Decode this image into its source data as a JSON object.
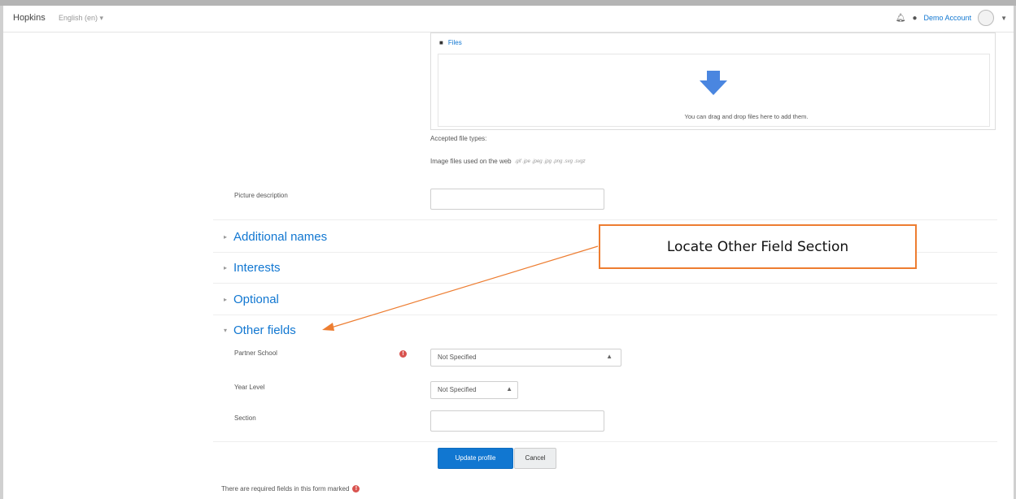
{
  "navbar": {
    "brand": "Hopkins",
    "language": "English (en) ▾",
    "user_name": "Demo Account",
    "icons": [
      "bell-icon",
      "chat-icon",
      "avatar",
      "chevron-down-icon"
    ]
  },
  "files_picker": {
    "header": "Files",
    "drop_text": "You can drag and drop files here to add them.",
    "accepted_label": "Accepted file types:",
    "accepted_types_label": "Image files used on the web",
    "accepted_types_ext": ".gif .jpe .jpeg .jpg .png .svg .svgz"
  },
  "picture_description": {
    "label": "Picture description",
    "value": ""
  },
  "sections": [
    {
      "label": "Additional names",
      "expanded": false
    },
    {
      "label": "Interests",
      "expanded": false
    },
    {
      "label": "Optional",
      "expanded": false
    },
    {
      "label": "Other fields",
      "expanded": true
    }
  ],
  "other_fields": {
    "partner_school": {
      "label": "Partner School",
      "value": "Not Specified",
      "required": true
    },
    "year_level": {
      "label": "Year Level",
      "value": "Not Specified"
    },
    "section": {
      "label": "Section",
      "value": ""
    }
  },
  "buttons": {
    "update": "Update profile",
    "cancel": "Cancel"
  },
  "footer_note": "There are required fields in this form marked",
  "annotation": {
    "text": "Locate Other Field Section",
    "color": "#ed7d31"
  },
  "colors": {
    "link": "#1177d1",
    "primary_button": "#1177d1",
    "required": "#d9534f",
    "annotation": "#ed7d31"
  }
}
